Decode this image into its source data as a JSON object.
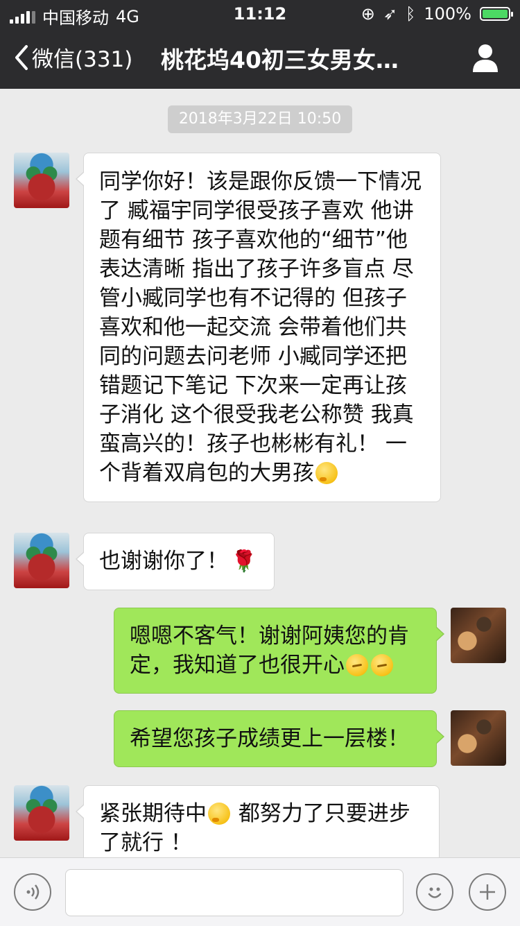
{
  "status_bar": {
    "carrier": "中国移动",
    "network": "4G",
    "time": "11:12",
    "battery": "100%"
  },
  "nav": {
    "back_label": "微信(331)",
    "title": "桃花坞40初三女男女…"
  },
  "chat": {
    "timestamp": "2018年3月22日 10:50",
    "messages": [
      {
        "side": "in",
        "text": "同学你好！该是跟你反馈一下情况了  臧福宇同学很受孩子喜欢  他讲题有细节  孩子喜欢他的“细节”他表达清晰  指出了孩子许多盲点  尽管小臧同学也有不记得的  但孩子喜欢和他一起交流  会带着他们共同的问题去问老师  小臧同学还把错题记下笔记  下次来一定再让孩子消化  这个很受我老公称赞  我真蛮高兴的！孩子也彬彬有礼！  一个背着双肩包的大男孩"
      },
      {
        "side": "in",
        "text": "也谢谢你了！"
      },
      {
        "side": "out",
        "text": "嗯嗯不客气！谢谢阿姨您的肯定，我知道了也很开心"
      },
      {
        "side": "out",
        "text": "希望您孩子成绩更上一层楼！"
      },
      {
        "side": "in",
        "text_a": "紧张期待中",
        "text_b": " 都努力了只要进步了就行 ！"
      }
    ]
  },
  "icons": {
    "back": "chevron-left-icon",
    "profile": "person-icon",
    "voice": "voice-icon",
    "emoji": "emoji-icon",
    "add": "plus-icon"
  },
  "colors": {
    "nav_bg": "#2c2c2e",
    "chat_bg": "#ebebeb",
    "incoming_bubble": "#ffffff",
    "outgoing_bubble": "#a0e75a",
    "battery": "#4cd964"
  }
}
